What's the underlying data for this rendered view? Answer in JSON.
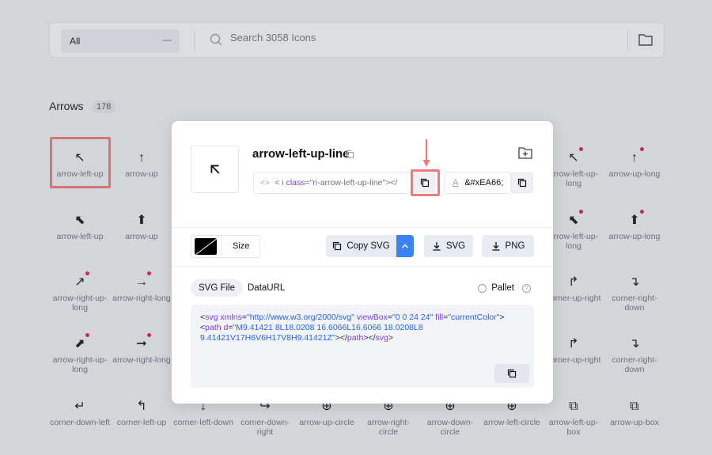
{
  "search": {
    "filter_value": "All",
    "placeholder": "Search 3058 Icons"
  },
  "section": {
    "title": "Arrows",
    "count": "178"
  },
  "grid": [
    {
      "glyph": "↖",
      "label": "arrow-left-up",
      "col": 0,
      "row": 0
    },
    {
      "glyph": "↑",
      "label": "arrow-up",
      "col": 1,
      "row": 0
    },
    {
      "glyph": "↖",
      "label": "arrow-left-up-long",
      "col": 8,
      "row": 0,
      "dot": true
    },
    {
      "glyph": "↑",
      "label": "arrow-up-long",
      "col": 9,
      "row": 0,
      "dot": true
    },
    {
      "glyph": "⬉",
      "label": "arrow-left-up",
      "col": 0,
      "row": 1
    },
    {
      "glyph": "⬆",
      "label": "arrow-up",
      "col": 1,
      "row": 1
    },
    {
      "glyph": "⬉",
      "label": "arrow-left-up-long",
      "col": 8,
      "row": 1,
      "dot": true
    },
    {
      "glyph": "⬆",
      "label": "arrow-up-long",
      "col": 9,
      "row": 1,
      "dot": true
    },
    {
      "glyph": "↗",
      "label": "arrow-right-up-long",
      "col": 0,
      "row": 2,
      "dot": true
    },
    {
      "glyph": "→",
      "label": "arrow-right-long",
      "col": 1,
      "row": 2,
      "dot": true
    },
    {
      "glyph": "↱",
      "label": "corner-up-right",
      "col": 8,
      "row": 2
    },
    {
      "glyph": "↴",
      "label": "corner-right-down",
      "col": 9,
      "row": 2
    },
    {
      "glyph": "⬈",
      "label": "arrow-right-up-long",
      "col": 0,
      "row": 3,
      "dot": true
    },
    {
      "glyph": "➞",
      "label": "arrow-right-long",
      "col": 1,
      "row": 3,
      "dot": true
    },
    {
      "glyph": "↱",
      "label": "corner-up-right",
      "col": 8,
      "row": 3
    },
    {
      "glyph": "↴",
      "label": "corner-right-down",
      "col": 9,
      "row": 3
    },
    {
      "glyph": "↵",
      "label": "corner-down-left",
      "col": 0,
      "row": 4
    },
    {
      "glyph": "↰",
      "label": "corner-left-up",
      "col": 1,
      "row": 4
    },
    {
      "glyph": "↓",
      "label": "corner-left-down",
      "col": 2,
      "row": 4
    },
    {
      "glyph": "↪",
      "label": "corner-down-right",
      "col": 3,
      "row": 4
    },
    {
      "glyph": "⊕",
      "label": "arrow-up-circle",
      "col": 4,
      "row": 4
    },
    {
      "glyph": "⊕",
      "label": "arrow-right-circle",
      "col": 5,
      "row": 4
    },
    {
      "glyph": "⊕",
      "label": "arrow-down-circle",
      "col": 6,
      "row": 4
    },
    {
      "glyph": "⊕",
      "label": "arrow-left-circle",
      "col": 7,
      "row": 4
    },
    {
      "glyph": "⧉",
      "label": "arrow-left-up-box",
      "col": 8,
      "row": 4
    },
    {
      "glyph": "⧉",
      "label": "arrow-up-box",
      "col": 9,
      "row": 4
    }
  ],
  "modal": {
    "icon_name": "arrow-left-up-line",
    "code_prefix": "<",
    "code_tag": "i",
    "code_attr": "class",
    "code_value": "=\"ri-arrow-left-up-line\"></",
    "unicode_value": "&#xEA66;",
    "size_label": "Size",
    "copy_svg_label": "Copy SVG",
    "svg_label": "SVG",
    "png_label": "PNG",
    "tabs": {
      "svg_file": "SVG File",
      "data_url": "DataURL"
    },
    "pallet_label": "Pallet",
    "help_glyph": "?",
    "svg_code": {
      "l1_open": "<",
      "l1_tag": "svg",
      "l1_attr1": "xmlns",
      "l1_val1": "\"http://www.w3.org/2000/svg\"",
      "l1_attr2": "viewBox",
      "l1_val2": "\"0 0 24 24\"",
      "l1_attr3": "fill",
      "l1_val3": "\"currentColor\"",
      "l1_close": ">",
      "l2_open": "<",
      "l2_tag": "path",
      "l2_attr": "d",
      "l2_val": "\"M9.41421 8L18.0208 16.6066L16.6066 18.0208L8 9.41421V17H6V6H17V8H9.41421Z\"",
      "l2_close": "></",
      "l2_endtag": "path",
      "l2_mid": "></",
      "l2_endsvg": "svg",
      "l2_final": ">"
    }
  },
  "colors": {
    "accent": "#3b82f6",
    "annotation": "#f07a7a",
    "dot": "#e11d48"
  }
}
